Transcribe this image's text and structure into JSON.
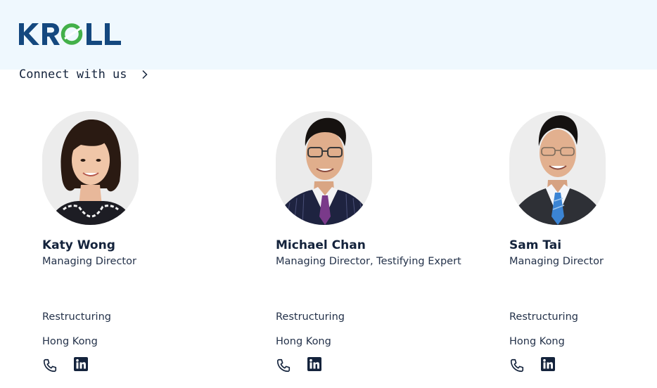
{
  "header": {
    "logo_text": "KROLL",
    "brand_color": "#14487f",
    "accent_color": "#43b049"
  },
  "connect": {
    "label": "Connect with us",
    "icon": "chevron-right-icon"
  },
  "people": [
    {
      "name": "Katy Wong",
      "title": "Managing Director",
      "service": "Restructuring",
      "location": "Hong Kong",
      "icons": [
        "phone-icon",
        "linkedin-icon"
      ]
    },
    {
      "name": "Michael Chan",
      "title": "Managing Director, Testifying Expert",
      "service": "Restructuring",
      "location": "Hong Kong",
      "icons": [
        "phone-icon",
        "linkedin-icon"
      ]
    },
    {
      "name": "Sam Tai",
      "title": "Managing Director",
      "service": "Restructuring",
      "location": "Hong Kong",
      "icons": [
        "phone-icon",
        "linkedin-icon"
      ]
    }
  ]
}
